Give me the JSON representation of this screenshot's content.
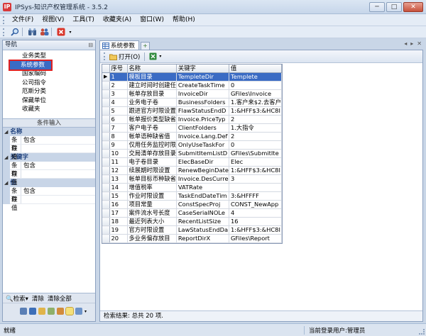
{
  "window": {
    "title": "IPSys-知识产权管理系统 - 3.5.2",
    "minimize": "─",
    "maximize": "□",
    "close": "✕"
  },
  "menu": [
    {
      "label": "文件(F)"
    },
    {
      "label": "视图(V)"
    },
    {
      "label": "工具(T)"
    },
    {
      "label": "收藏夹(A)"
    },
    {
      "label": "窗口(W)"
    },
    {
      "label": "帮助(H)"
    }
  ],
  "toolbar_icons": [
    "search-icon",
    "binoculars-icon",
    "users-icon",
    "close-red-icon"
  ],
  "nav": {
    "title": "导航",
    "items": [
      {
        "label": "业务类型"
      },
      {
        "label": "系统参数"
      },
      {
        "label": "国家编码"
      },
      {
        "label": "公司指令"
      },
      {
        "label": "厄斯分类"
      },
      {
        "label": "保藏单位"
      },
      {
        "label": "收藏夹"
      }
    ],
    "selected_index": 1
  },
  "conditions": {
    "title": "条件输入",
    "groups": [
      {
        "name": "名称",
        "rows": [
          {
            "k": "条件",
            "v": "包含"
          },
          {
            "k": "取值",
            "v": ""
          }
        ]
      },
      {
        "name": "关键字",
        "rows": [
          {
            "k": "条件",
            "v": "包含"
          },
          {
            "k": "取值",
            "v": ""
          }
        ]
      },
      {
        "name": "值",
        "rows": [
          {
            "k": "条件",
            "v": "包含"
          },
          {
            "k": "取值",
            "v": ""
          }
        ]
      }
    ]
  },
  "left_actions": {
    "search": "检索",
    "clear": "清除",
    "clear_all": "清除全部"
  },
  "tab": {
    "label": "系统参数"
  },
  "right_toolbar": {
    "open": "打开(O)"
  },
  "table": {
    "headers": {
      "no": "序号",
      "name": "名称",
      "key": "关键字",
      "value": "值"
    },
    "rows": [
      {
        "no": "1",
        "name": "模板目录",
        "key": "TempleteDir",
        "value": "Templete"
      },
      {
        "no": "2",
        "name": "建立时间时创建任",
        "key": "CreateTaskTime",
        "value": "0"
      },
      {
        "no": "3",
        "name": "帐单存放目录",
        "key": "InvoiceDir",
        "value": "GFiles\\Invoice"
      },
      {
        "no": "4",
        "name": "业务电子卷",
        "key": "BusinessFolders",
        "value": "1.客户来$2.去客户"
      },
      {
        "no": "5",
        "name": "跟进官方时限设置",
        "key": "FlawStatusEndD",
        "value": "1:&HFF$3:&HC8I"
      },
      {
        "no": "6",
        "name": "帐单报价类型缺省",
        "key": "Invoice.PriceTyp",
        "value": "2"
      },
      {
        "no": "7",
        "name": "客户电子卷",
        "key": "ClientFolders",
        "value": "1.大指令"
      },
      {
        "no": "8",
        "name": "帐单语种缺省值",
        "key": "Invoice.Lang.Def",
        "value": "2"
      },
      {
        "no": "9",
        "name": "仅用任务监控时限",
        "key": "OnlyUseTaskFor",
        "value": "0"
      },
      {
        "no": "10",
        "name": "交局清单存放目录",
        "key": "SubmitItemListD",
        "value": "GFiles\\SubmitIte"
      },
      {
        "no": "11",
        "name": "电子卷目录",
        "key": "ElecBaseDir",
        "value": "Elec"
      },
      {
        "no": "12",
        "name": "续展期时限设置",
        "key": "RenewBeginDate",
        "value": "1:&HFF$3:&HC8I"
      },
      {
        "no": "13",
        "name": "帐单目标币种缺省",
        "key": "Invoice.DesCurre",
        "value": "3"
      },
      {
        "no": "14",
        "name": "增值税率",
        "key": "VATRate",
        "value": ""
      },
      {
        "no": "15",
        "name": "作业时限设置",
        "key": "TaskEndDateTim",
        "value": "3:&HFFFF"
      },
      {
        "no": "16",
        "name": "项目常量",
        "key": "ConstSpecProj",
        "value": "CONST_NewApp"
      },
      {
        "no": "17",
        "name": "案件流水号长度",
        "key": "CaseSerialNOLe",
        "value": "4"
      },
      {
        "no": "18",
        "name": "最近列表大小",
        "key": "RecentListSize",
        "value": "16"
      },
      {
        "no": "19",
        "name": "官方时限设置",
        "key": "LawStatusEndDa",
        "value": "1:&HFF$3:&HC8I"
      },
      {
        "no": "20",
        "name": "多业务偏存放目",
        "key": "ReportDirX",
        "value": "GFiles\\Report"
      }
    ],
    "selected_index": 0
  },
  "search_result": "检索结果: 总共 20 项.",
  "status": {
    "left": "就绪",
    "right": "当前登录用户:管理员"
  }
}
